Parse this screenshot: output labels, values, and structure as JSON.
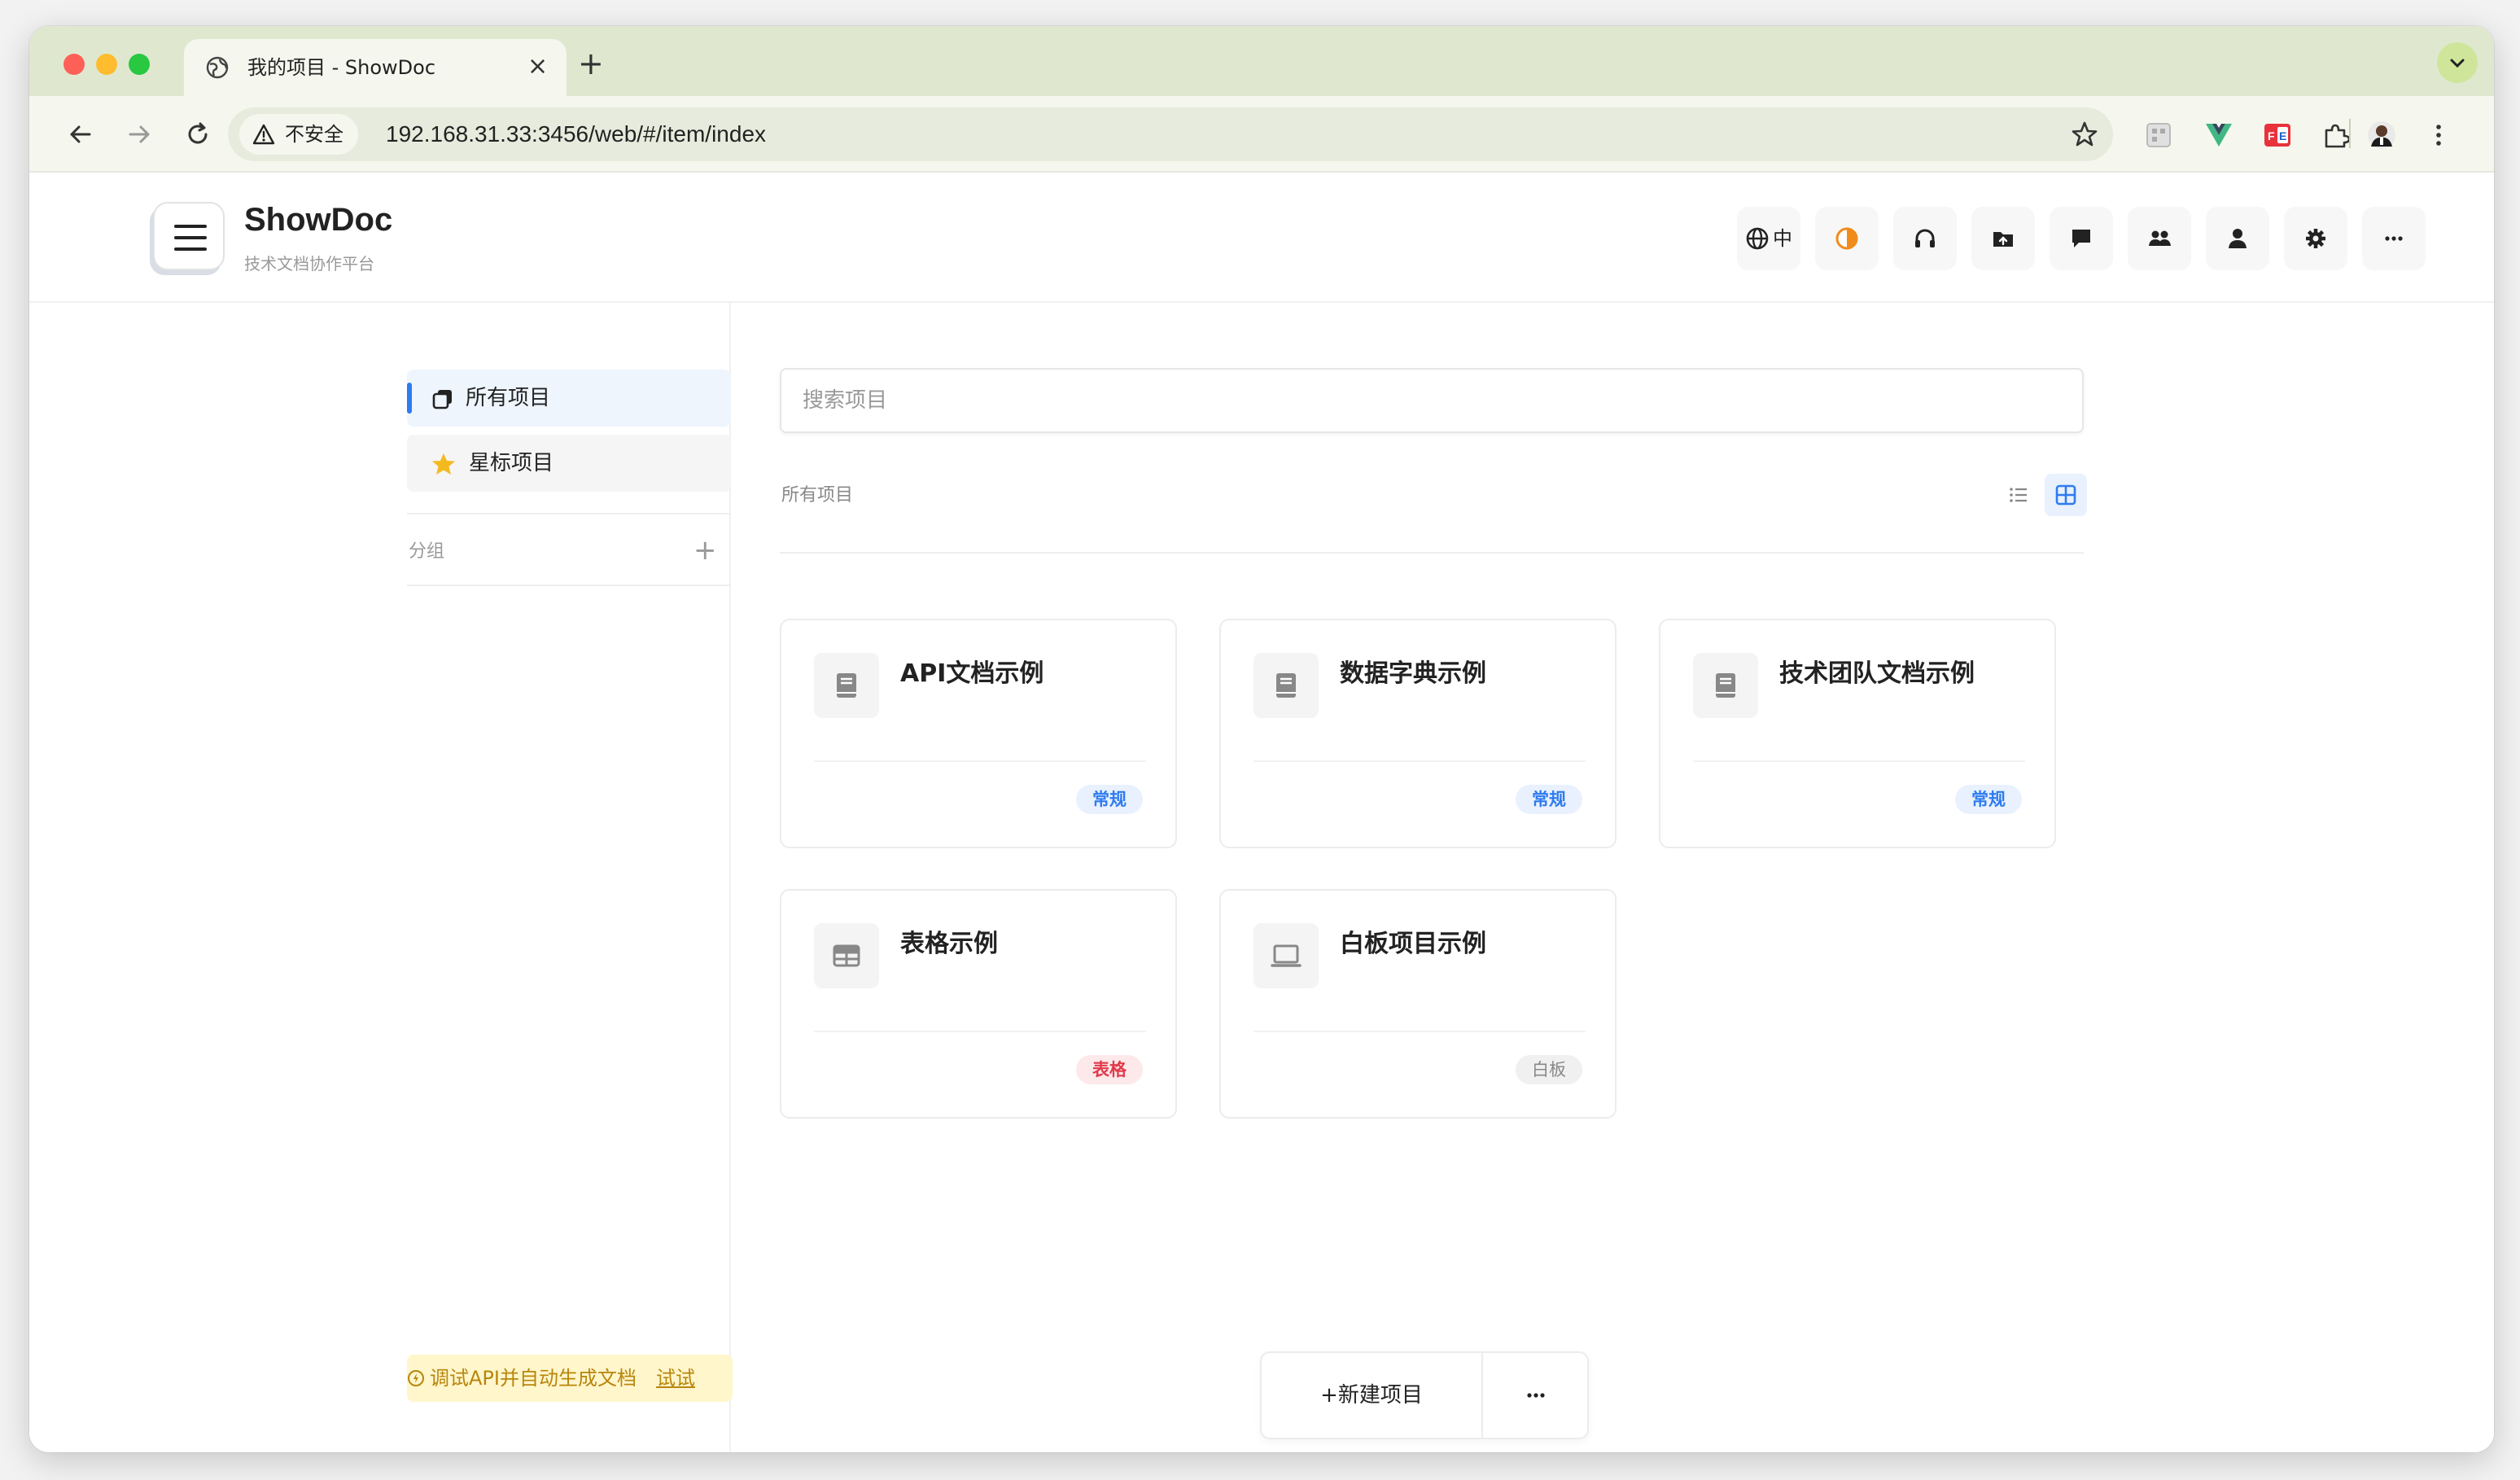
{
  "browser": {
    "tab_title": "我的项目 - ShowDoc",
    "security_label": "不安全",
    "url": "192.168.31.33:3456/web/#/item/index"
  },
  "header": {
    "brand": "ShowDoc",
    "tagline": "技术文档协作平台",
    "lang_label": "中"
  },
  "sidebar": {
    "all_projects": "所有项目",
    "starred_projects": "星标项目",
    "group_label": "分组",
    "group_add": "+",
    "promo_text": "调试API并自动生成文档",
    "promo_link": "试试"
  },
  "main": {
    "search_placeholder": "搜索项目",
    "breadcrumb": "所有项目",
    "new_project": "+新建项目",
    "projects": [
      {
        "title": "API文档示例",
        "badge": "常规"
      },
      {
        "title": "数据字典示例",
        "badge": "常规"
      },
      {
        "title": "技术团队文档示例",
        "badge": "常规"
      },
      {
        "title": "表格示例",
        "badge": "表格"
      },
      {
        "title": "白板项目示例",
        "badge": "白板"
      }
    ]
  },
  "colors": {
    "accent": "#2f7bf0",
    "badge_table": "#e03a4a",
    "promo": "#b8860b",
    "chrome": "#dfe8cf"
  }
}
